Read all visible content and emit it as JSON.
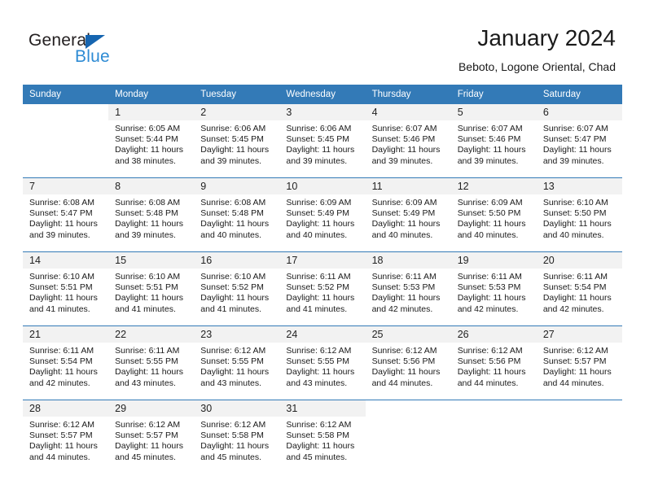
{
  "logo": {
    "word_one": "General",
    "word_two": "Blue",
    "triangle_color": "#1665b0",
    "blue_color": "#2e8bd4"
  },
  "header": {
    "month_title": "January 2024",
    "location": "Beboto, Logone Oriental, Chad"
  },
  "theme": {
    "header_blue": "#337ab7",
    "daynum_band": "#f2f2f2",
    "text": "#1a1a1a"
  },
  "weekday_headers": [
    "Sunday",
    "Monday",
    "Tuesday",
    "Wednesday",
    "Thursday",
    "Friday",
    "Saturday"
  ],
  "weeks": [
    [
      {
        "day": "",
        "sunrise": "",
        "sunset": "",
        "daylight_line1": "",
        "daylight_line2": "",
        "blank": true
      },
      {
        "day": "1",
        "sunrise": "Sunrise: 6:05 AM",
        "sunset": "Sunset: 5:44 PM",
        "daylight_line1": "Daylight: 11 hours",
        "daylight_line2": "and 38 minutes."
      },
      {
        "day": "2",
        "sunrise": "Sunrise: 6:06 AM",
        "sunset": "Sunset: 5:45 PM",
        "daylight_line1": "Daylight: 11 hours",
        "daylight_line2": "and 39 minutes."
      },
      {
        "day": "3",
        "sunrise": "Sunrise: 6:06 AM",
        "sunset": "Sunset: 5:45 PM",
        "daylight_line1": "Daylight: 11 hours",
        "daylight_line2": "and 39 minutes."
      },
      {
        "day": "4",
        "sunrise": "Sunrise: 6:07 AM",
        "sunset": "Sunset: 5:46 PM",
        "daylight_line1": "Daylight: 11 hours",
        "daylight_line2": "and 39 minutes."
      },
      {
        "day": "5",
        "sunrise": "Sunrise: 6:07 AM",
        "sunset": "Sunset: 5:46 PM",
        "daylight_line1": "Daylight: 11 hours",
        "daylight_line2": "and 39 minutes."
      },
      {
        "day": "6",
        "sunrise": "Sunrise: 6:07 AM",
        "sunset": "Sunset: 5:47 PM",
        "daylight_line1": "Daylight: 11 hours",
        "daylight_line2": "and 39 minutes."
      }
    ],
    [
      {
        "day": "7",
        "sunrise": "Sunrise: 6:08 AM",
        "sunset": "Sunset: 5:47 PM",
        "daylight_line1": "Daylight: 11 hours",
        "daylight_line2": "and 39 minutes."
      },
      {
        "day": "8",
        "sunrise": "Sunrise: 6:08 AM",
        "sunset": "Sunset: 5:48 PM",
        "daylight_line1": "Daylight: 11 hours",
        "daylight_line2": "and 39 minutes."
      },
      {
        "day": "9",
        "sunrise": "Sunrise: 6:08 AM",
        "sunset": "Sunset: 5:48 PM",
        "daylight_line1": "Daylight: 11 hours",
        "daylight_line2": "and 40 minutes."
      },
      {
        "day": "10",
        "sunrise": "Sunrise: 6:09 AM",
        "sunset": "Sunset: 5:49 PM",
        "daylight_line1": "Daylight: 11 hours",
        "daylight_line2": "and 40 minutes."
      },
      {
        "day": "11",
        "sunrise": "Sunrise: 6:09 AM",
        "sunset": "Sunset: 5:49 PM",
        "daylight_line1": "Daylight: 11 hours",
        "daylight_line2": "and 40 minutes."
      },
      {
        "day": "12",
        "sunrise": "Sunrise: 6:09 AM",
        "sunset": "Sunset: 5:50 PM",
        "daylight_line1": "Daylight: 11 hours",
        "daylight_line2": "and 40 minutes."
      },
      {
        "day": "13",
        "sunrise": "Sunrise: 6:10 AM",
        "sunset": "Sunset: 5:50 PM",
        "daylight_line1": "Daylight: 11 hours",
        "daylight_line2": "and 40 minutes."
      }
    ],
    [
      {
        "day": "14",
        "sunrise": "Sunrise: 6:10 AM",
        "sunset": "Sunset: 5:51 PM",
        "daylight_line1": "Daylight: 11 hours",
        "daylight_line2": "and 41 minutes."
      },
      {
        "day": "15",
        "sunrise": "Sunrise: 6:10 AM",
        "sunset": "Sunset: 5:51 PM",
        "daylight_line1": "Daylight: 11 hours",
        "daylight_line2": "and 41 minutes."
      },
      {
        "day": "16",
        "sunrise": "Sunrise: 6:10 AM",
        "sunset": "Sunset: 5:52 PM",
        "daylight_line1": "Daylight: 11 hours",
        "daylight_line2": "and 41 minutes."
      },
      {
        "day": "17",
        "sunrise": "Sunrise: 6:11 AM",
        "sunset": "Sunset: 5:52 PM",
        "daylight_line1": "Daylight: 11 hours",
        "daylight_line2": "and 41 minutes."
      },
      {
        "day": "18",
        "sunrise": "Sunrise: 6:11 AM",
        "sunset": "Sunset: 5:53 PM",
        "daylight_line1": "Daylight: 11 hours",
        "daylight_line2": "and 42 minutes."
      },
      {
        "day": "19",
        "sunrise": "Sunrise: 6:11 AM",
        "sunset": "Sunset: 5:53 PM",
        "daylight_line1": "Daylight: 11 hours",
        "daylight_line2": "and 42 minutes."
      },
      {
        "day": "20",
        "sunrise": "Sunrise: 6:11 AM",
        "sunset": "Sunset: 5:54 PM",
        "daylight_line1": "Daylight: 11 hours",
        "daylight_line2": "and 42 minutes."
      }
    ],
    [
      {
        "day": "21",
        "sunrise": "Sunrise: 6:11 AM",
        "sunset": "Sunset: 5:54 PM",
        "daylight_line1": "Daylight: 11 hours",
        "daylight_line2": "and 42 minutes."
      },
      {
        "day": "22",
        "sunrise": "Sunrise: 6:11 AM",
        "sunset": "Sunset: 5:55 PM",
        "daylight_line1": "Daylight: 11 hours",
        "daylight_line2": "and 43 minutes."
      },
      {
        "day": "23",
        "sunrise": "Sunrise: 6:12 AM",
        "sunset": "Sunset: 5:55 PM",
        "daylight_line1": "Daylight: 11 hours",
        "daylight_line2": "and 43 minutes."
      },
      {
        "day": "24",
        "sunrise": "Sunrise: 6:12 AM",
        "sunset": "Sunset: 5:55 PM",
        "daylight_line1": "Daylight: 11 hours",
        "daylight_line2": "and 43 minutes."
      },
      {
        "day": "25",
        "sunrise": "Sunrise: 6:12 AM",
        "sunset": "Sunset: 5:56 PM",
        "daylight_line1": "Daylight: 11 hours",
        "daylight_line2": "and 44 minutes."
      },
      {
        "day": "26",
        "sunrise": "Sunrise: 6:12 AM",
        "sunset": "Sunset: 5:56 PM",
        "daylight_line1": "Daylight: 11 hours",
        "daylight_line2": "and 44 minutes."
      },
      {
        "day": "27",
        "sunrise": "Sunrise: 6:12 AM",
        "sunset": "Sunset: 5:57 PM",
        "daylight_line1": "Daylight: 11 hours",
        "daylight_line2": "and 44 minutes."
      }
    ],
    [
      {
        "day": "28",
        "sunrise": "Sunrise: 6:12 AM",
        "sunset": "Sunset: 5:57 PM",
        "daylight_line1": "Daylight: 11 hours",
        "daylight_line2": "and 44 minutes."
      },
      {
        "day": "29",
        "sunrise": "Sunrise: 6:12 AM",
        "sunset": "Sunset: 5:57 PM",
        "daylight_line1": "Daylight: 11 hours",
        "daylight_line2": "and 45 minutes."
      },
      {
        "day": "30",
        "sunrise": "Sunrise: 6:12 AM",
        "sunset": "Sunset: 5:58 PM",
        "daylight_line1": "Daylight: 11 hours",
        "daylight_line2": "and 45 minutes."
      },
      {
        "day": "31",
        "sunrise": "Sunrise: 6:12 AM",
        "sunset": "Sunset: 5:58 PM",
        "daylight_line1": "Daylight: 11 hours",
        "daylight_line2": "and 45 minutes."
      },
      {
        "day": "",
        "sunrise": "",
        "sunset": "",
        "daylight_line1": "",
        "daylight_line2": "",
        "blank": true
      },
      {
        "day": "",
        "sunrise": "",
        "sunset": "",
        "daylight_line1": "",
        "daylight_line2": "",
        "blank": true
      },
      {
        "day": "",
        "sunrise": "",
        "sunset": "",
        "daylight_line1": "",
        "daylight_line2": "",
        "blank": true
      }
    ]
  ]
}
